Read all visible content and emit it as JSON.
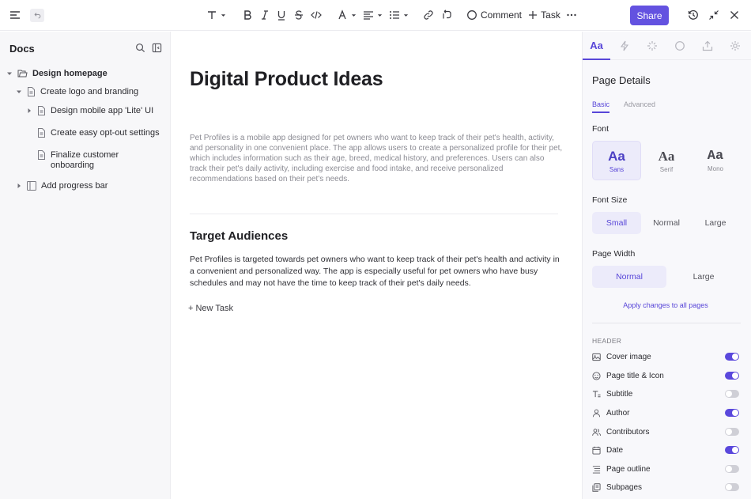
{
  "toolbar": {
    "comment_label": "Comment",
    "task_label": "Task",
    "share_label": "Share"
  },
  "sidebar": {
    "title": "Docs",
    "items": [
      {
        "label": "Design homepage"
      },
      {
        "label": "Create logo and branding"
      },
      {
        "label": "Design mobile app 'Lite' UI"
      },
      {
        "label": "Create easy opt-out settings"
      },
      {
        "label": "Finalize customer onboarding"
      },
      {
        "label": "Add progress bar"
      }
    ]
  },
  "document": {
    "title": "Digital Product Ideas",
    "subtitle": "Pet Profiles is a mobile app designed for pet owners who want to keep track of their pet's health, activity, and personality in one convenient place. The app allows users to create a personalized profile for their pet, which includes information such as their age, breed, medical history, and preferences. Users can also track their pet's daily activity, including exercise and food intake, and receive personalized recommendations based on their pet's needs.",
    "section_heading": "Target Audiences",
    "section_body": "Pet Profiles is targeted towards pet owners who want to keep track of their pet's health and activity in a convenient and personalized way. The app is especially useful for pet owners who have busy schedules and may not have the time to keep track of their pet's daily needs.",
    "new_task_label": "+ New Task"
  },
  "panel": {
    "active_tab_label": "Aa",
    "title": "Page Details",
    "subtabs": {
      "basic": "Basic",
      "advanced": "Advanced"
    },
    "font": {
      "label": "Font",
      "options": [
        {
          "glyph": "Aa",
          "name": "Sans"
        },
        {
          "glyph": "Aa",
          "name": "Serif"
        },
        {
          "glyph": "Aa",
          "name": "Mono"
        }
      ],
      "selected": "Sans"
    },
    "font_size": {
      "label": "Font Size",
      "options": [
        "Small",
        "Normal",
        "Large"
      ],
      "selected": "Small"
    },
    "page_width": {
      "label": "Page Width",
      "options": [
        "Normal",
        "Large"
      ],
      "selected": "Normal"
    },
    "apply_link": "Apply changes to all pages",
    "header_label": "HEADER",
    "header_options": [
      {
        "label": "Cover image",
        "icon": "image-icon",
        "on": true
      },
      {
        "label": "Page title & Icon",
        "icon": "smiley-icon",
        "on": true
      },
      {
        "label": "Subtitle",
        "icon": "text-icon",
        "on": false
      },
      {
        "label": "Author",
        "icon": "user-icon",
        "on": true
      },
      {
        "label": "Contributors",
        "icon": "users-icon",
        "on": false
      },
      {
        "label": "Date",
        "icon": "calendar-icon",
        "on": true
      },
      {
        "label": "Page outline",
        "icon": "outline-icon",
        "on": false
      },
      {
        "label": "Subpages",
        "icon": "subpages-icon",
        "on": false
      }
    ]
  },
  "colors": {
    "accent": "#5846d8",
    "share_button": "#6352e0"
  }
}
